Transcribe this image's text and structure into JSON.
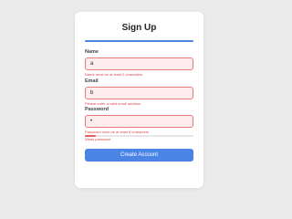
{
  "form": {
    "title": "Sign Up",
    "name": {
      "label": "Name",
      "value": "a",
      "error": "Name must be at least 2 characters"
    },
    "email": {
      "label": "Email",
      "value": "b",
      "error": "Please enter a valid email address"
    },
    "password": {
      "label": "Password",
      "masked_value": "•",
      "error": "Password must be at least 8 characters",
      "strength_label": "Weak password",
      "strength_fraction": 0.1
    },
    "submit_label": "Create Account"
  },
  "colors": {
    "accent": "#4a85e6",
    "error": "#d84a4a",
    "field_error_bg": "#fdeced",
    "field_error_border": "#e37b7b"
  }
}
